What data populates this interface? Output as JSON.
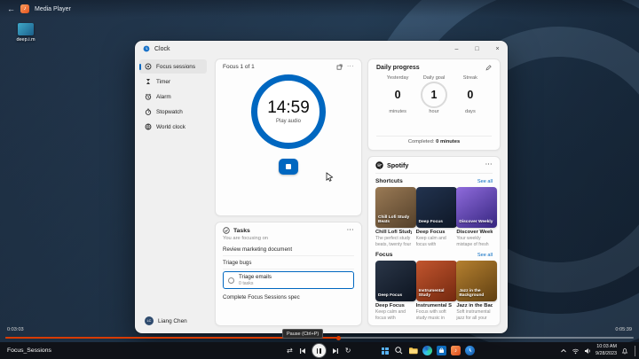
{
  "colors": {
    "accent": "#0067c0",
    "seek": "#d83b01"
  },
  "media_player": {
    "app_title": "Media Player",
    "back_glyph": "←",
    "library_item_label": "deep.i.m",
    "now_playing_title": "Focus_Sessions",
    "elapsed": "0:03:03",
    "duration": "0:05:39",
    "progress_width": "53%",
    "pause_tooltip": "Pause (Ctrl+P)",
    "shuffle_glyph": "⇄",
    "repeat_glyph": "↻"
  },
  "clock_app": {
    "window_title": "Clock",
    "more_glyph": "···",
    "window_controls": {
      "minimize": "–",
      "maximize": "□",
      "close": "×"
    },
    "sidebar": {
      "items": [
        {
          "label": "Focus sessions",
          "active": true
        },
        {
          "label": "Timer"
        },
        {
          "label": "Alarm"
        },
        {
          "label": "Stopwatch"
        },
        {
          "label": "World clock"
        }
      ],
      "user_name": "Liang Chen",
      "user_initials": "LC"
    },
    "focus_session": {
      "header": "Focus 1 of 1",
      "timer": "14:59",
      "audio_label": "Play audio"
    },
    "daily_progress": {
      "title": "Daily progress",
      "stats": [
        {
          "label": "Yesterday",
          "value": "0",
          "unit": "minutes"
        },
        {
          "label": "Daily goal",
          "value": "1",
          "unit": "hour"
        },
        {
          "label": "Streak",
          "value": "0",
          "unit": "days"
        }
      ],
      "completed_label": "Completed:",
      "completed_value": "0 minutes"
    },
    "tasks": {
      "title": "Tasks",
      "focusing_label": "You are focusing on",
      "items": [
        {
          "label": "Review marketing document"
        },
        {
          "label": "Triage bugs"
        },
        {
          "label": "Triage emails",
          "meta": "0 tasks",
          "selected": true
        },
        {
          "label": "Complete Focus Sessions spec"
        }
      ]
    },
    "spotify": {
      "title": "Spotify",
      "sections": [
        {
          "heading": "Shortcuts",
          "link_label": "See all",
          "tiles": [
            {
              "title": "Chill Lofi Study B...",
              "cover_label": "Chill Lofi Study Beats",
              "desc": "The perfect study beats, twenty four seven...",
              "cover": "linear-gradient(145deg,#9a7a55,#54402a)"
            },
            {
              "title": "Deep Focus",
              "cover_label": "Deep Focus",
              "desc": "Keep calm and focus with ambient and post-rock...",
              "cover": "linear-gradient(145deg,#22334f,#0e1726)"
            },
            {
              "title": "Discover Weekly",
              "cover_label": "Discover Weekly",
              "desc": "Your weekly mixtape of fresh music. Enjoy...",
              "cover": "linear-gradient(145deg,#8f6bdc,#35257f)"
            }
          ]
        },
        {
          "heading": "Focus",
          "link_label": "See all",
          "tiles": [
            {
              "title": "Deep Focus",
              "cover_label": "Deep Focus",
              "desc": "Keep calm and focus with ambient and post-rock...",
              "cover": "linear-gradient(145deg,#2a3648,#0d1420)"
            },
            {
              "title": "Instrumental Study",
              "cover_label": "Instrumental Study",
              "desc": "Focus with soft study music in the background...",
              "cover": "linear-gradient(145deg,#c2552e,#73280f)"
            },
            {
              "title": "Jazz in the Backg...",
              "cover_label": "Jazz in the Background",
              "desc": "Soft instrumental jazz for all your activities...",
              "cover": "linear-gradient(145deg,#b5802f,#5f3f12)"
            }
          ]
        }
      ]
    }
  },
  "taskbar": {
    "app_icons": [
      "start-icon",
      "search-icon",
      "file-explorer-icon",
      "edge-icon",
      "store-icon",
      "media-player-icon",
      "clock-icon"
    ],
    "tray": {
      "time": "10:03 AM",
      "date": "9/28/2023"
    }
  }
}
